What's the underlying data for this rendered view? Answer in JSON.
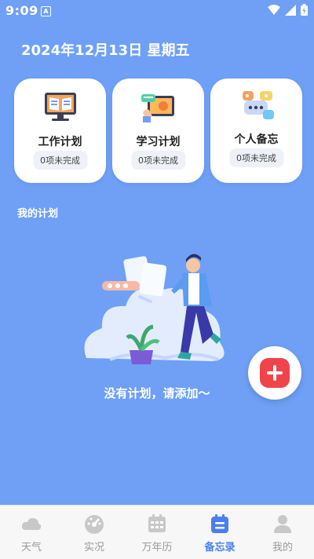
{
  "status_bar": {
    "time": "9:09",
    "notification_icon": "A"
  },
  "header": {
    "date": "2024年12月13日  星期五"
  },
  "cards": [
    {
      "title": "工作计划",
      "badge": "0项未完成",
      "icon": "monitor-book-icon"
    },
    {
      "title": "学习计划",
      "badge": "0项未完成",
      "icon": "tablet-study-icon"
    },
    {
      "title": "个人备忘",
      "badge": "0项未完成",
      "icon": "chat-bubbles-icon"
    }
  ],
  "section": {
    "title": "我的计划"
  },
  "empty_state": {
    "text": "没有计划，请添加～"
  },
  "fab": {
    "icon": "plus-icon",
    "color": "#f0444c"
  },
  "bottom_nav": {
    "active_color": "#4a7ff0",
    "items": [
      {
        "label": "天气",
        "icon": "cloud-icon"
      },
      {
        "label": "实况",
        "icon": "gauge-icon"
      },
      {
        "label": "万年历",
        "icon": "calendar-icon"
      },
      {
        "label": "备忘录",
        "icon": "memo-icon",
        "active": true
      },
      {
        "label": "我的",
        "icon": "person-icon"
      }
    ]
  }
}
